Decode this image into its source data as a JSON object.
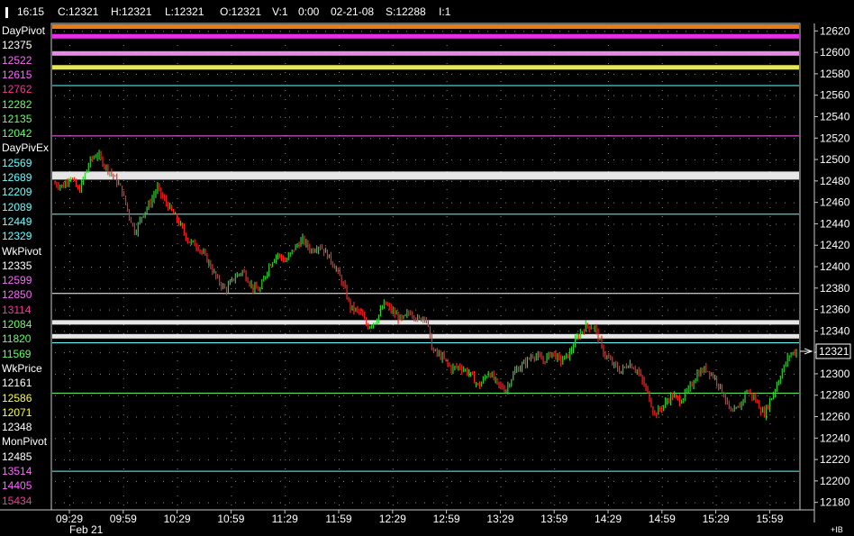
{
  "status_bar": {
    "time": "16:15",
    "close": "C:12321",
    "high": "H:12321",
    "low": "L:12321",
    "open": "O:12321",
    "volume": "V:1",
    "elapsed": "0:00",
    "date": "02-21-08",
    "settle": "S:12288",
    "interval": "I:1"
  },
  "side_labels": [
    {
      "text": "DayPivot",
      "color": "#ffffff"
    },
    {
      "text": "12375",
      "color": "#ffffff"
    },
    {
      "text": "12522",
      "color": "#ff66ff"
    },
    {
      "text": "12615",
      "color": "#ff66ff"
    },
    {
      "text": "12762",
      "color": "#ff3399"
    },
    {
      "text": "12282",
      "color": "#66ff66"
    },
    {
      "text": "12135",
      "color": "#66ff66"
    },
    {
      "text": "12042",
      "color": "#66ff66"
    },
    {
      "text": "DayPivEx",
      "color": "#ffffff"
    },
    {
      "text": "12569",
      "color": "#66ffff"
    },
    {
      "text": "12689",
      "color": "#66ffff"
    },
    {
      "text": "12209",
      "color": "#66ffff"
    },
    {
      "text": "12089",
      "color": "#66ffff"
    },
    {
      "text": "12449",
      "color": "#66ffff"
    },
    {
      "text": "12329",
      "color": "#66ffff"
    },
    {
      "text": "WkPivot",
      "color": "#ffffff"
    },
    {
      "text": "12335",
      "color": "#ffffff"
    },
    {
      "text": "12599",
      "color": "#ff66ff"
    },
    {
      "text": "12850",
      "color": "#ff66ff"
    },
    {
      "text": "13114",
      "color": "#ff3399"
    },
    {
      "text": "12084",
      "color": "#66ff66"
    },
    {
      "text": "11820",
      "color": "#66ff66"
    },
    {
      "text": "11569",
      "color": "#66ff66"
    },
    {
      "text": "WkPrice",
      "color": "#ffffff"
    },
    {
      "text": "12161",
      "color": "#ffffff"
    },
    {
      "text": "12586",
      "color": "#ffff33"
    },
    {
      "text": "12071",
      "color": "#ffff33"
    },
    {
      "text": "12348",
      "color": "#ffffff"
    },
    {
      "text": "MonPivot",
      "color": "#ffffff"
    },
    {
      "text": "12485",
      "color": "#ffffff"
    },
    {
      "text": "13514",
      "color": "#ff66ff"
    },
    {
      "text": "14405",
      "color": "#ff66ff"
    },
    {
      "text": "15434",
      "color": "#ff3399"
    }
  ],
  "axis_footer": "+IB",
  "chart_data": {
    "type": "candlestick",
    "x_tick_labels": [
      "09:29",
      "09:59",
      "10:29",
      "10:59",
      "11:29",
      "11:59",
      "12:29",
      "12:59",
      "13:29",
      "13:59",
      "14:29",
      "14:59",
      "15:29",
      "15:59"
    ],
    "date_label": "Feb 21",
    "y_tick_labels": [
      12620,
      12600,
      12580,
      12560,
      12540,
      12520,
      12500,
      12480,
      12460,
      12440,
      12420,
      12400,
      12380,
      12360,
      12340,
      12320,
      12300,
      12280,
      12260,
      12240,
      12220,
      12200,
      12180
    ],
    "ylim": [
      12173,
      12627
    ],
    "last_price": "12321",
    "grid": true,
    "colors": {
      "up": "#33cc33",
      "down": "#ff2222",
      "grid_dots": "#8a8a8a"
    },
    "pivot_lines": [
      {
        "price": 12624,
        "color": "#ff8c1a",
        "style": "band"
      },
      {
        "price": 12615,
        "color": "#ff33ff",
        "style": "band"
      },
      {
        "price": 12599,
        "color": "#ff99ff",
        "style": "band"
      },
      {
        "price": 12586,
        "color": "#ffff66",
        "style": "band"
      },
      {
        "price": 12569,
        "color": "#66ffff",
        "style": "line"
      },
      {
        "price": 12522,
        "color": "#ff66ff",
        "style": "line"
      },
      {
        "price": 12485,
        "color": "#ffffff",
        "style": "band"
      },
      {
        "price": 12449,
        "color": "#66ffff",
        "style": "line"
      },
      {
        "price": 12375,
        "color": "#ffffff",
        "style": "line"
      },
      {
        "price": 12348,
        "color": "#ffffff",
        "style": "band"
      },
      {
        "price": 12335,
        "color": "#ffffff",
        "style": "band"
      },
      {
        "price": 12329,
        "color": "#66ffff",
        "style": "line"
      },
      {
        "price": 12282,
        "color": "#66ff66",
        "style": "line"
      },
      {
        "price": 12209,
        "color": "#66ffff",
        "style": "line"
      }
    ],
    "price_path": [
      [
        0,
        12478
      ],
      [
        6,
        12475
      ],
      [
        10,
        12485
      ],
      [
        15,
        12470
      ],
      [
        19,
        12488
      ],
      [
        22,
        12500
      ],
      [
        26,
        12505
      ],
      [
        30,
        12495
      ],
      [
        35,
        12485
      ],
      [
        40,
        12472
      ],
      [
        44,
        12450
      ],
      [
        48,
        12432
      ],
      [
        52,
        12448
      ],
      [
        57,
        12460
      ],
      [
        61,
        12474
      ],
      [
        64,
        12465
      ],
      [
        70,
        12450
      ],
      [
        74,
        12440
      ],
      [
        79,
        12424
      ],
      [
        84,
        12420
      ],
      [
        90,
        12407
      ],
      [
        96,
        12388
      ],
      [
        101,
        12378
      ],
      [
        106,
        12390
      ],
      [
        111,
        12396
      ],
      [
        117,
        12380
      ],
      [
        121,
        12378
      ],
      [
        126,
        12400
      ],
      [
        131,
        12412
      ],
      [
        136,
        12405
      ],
      [
        141,
        12417
      ],
      [
        146,
        12425
      ],
      [
        151,
        12415
      ],
      [
        156,
        12420
      ],
      [
        161,
        12410
      ],
      [
        166,
        12397
      ],
      [
        170,
        12382
      ],
      [
        174,
        12362
      ],
      [
        180,
        12357
      ],
      [
        184,
        12344
      ],
      [
        189,
        12350
      ],
      [
        194,
        12366
      ],
      [
        199,
        12357
      ],
      [
        204,
        12350
      ],
      [
        209,
        12358
      ],
      [
        214,
        12350
      ],
      [
        218,
        12355
      ],
      [
        222,
        12322
      ],
      [
        228,
        12315
      ],
      [
        233,
        12305
      ],
      [
        238,
        12307
      ],
      [
        244,
        12300
      ],
      [
        249,
        12288
      ],
      [
        255,
        12302
      ],
      [
        260,
        12290
      ],
      [
        265,
        12285
      ],
      [
        270,
        12302
      ],
      [
        276,
        12310
      ],
      [
        281,
        12318
      ],
      [
        287,
        12312
      ],
      [
        292,
        12320
      ],
      [
        297,
        12312
      ],
      [
        302,
        12318
      ],
      [
        307,
        12335
      ],
      [
        312,
        12345
      ],
      [
        317,
        12343
      ],
      [
        322,
        12320
      ],
      [
        327,
        12310
      ],
      [
        332,
        12302
      ],
      [
        337,
        12310
      ],
      [
        342,
        12303
      ],
      [
        348,
        12282
      ],
      [
        352,
        12262
      ],
      [
        357,
        12270
      ],
      [
        362,
        12280
      ],
      [
        367,
        12275
      ],
      [
        372,
        12285
      ],
      [
        377,
        12300
      ],
      [
        382,
        12305
      ],
      [
        387,
        12297
      ],
      [
        392,
        12283
      ],
      [
        397,
        12262
      ],
      [
        402,
        12270
      ],
      [
        406,
        12285
      ],
      [
        411,
        12276
      ],
      [
        416,
        12262
      ],
      [
        421,
        12280
      ],
      [
        426,
        12300
      ],
      [
        431,
        12318
      ],
      [
        435,
        12321
      ]
    ]
  }
}
